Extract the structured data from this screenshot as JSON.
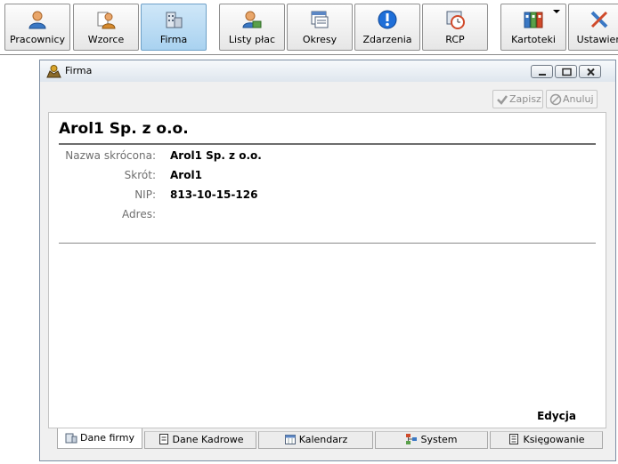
{
  "toolbar": {
    "items": [
      {
        "label": "Pracownicy",
        "icon": "user-icon"
      },
      {
        "label": "Wzorce",
        "icon": "templates-icon"
      },
      {
        "label": "Firma",
        "icon": "building-icon",
        "active": true
      },
      {
        "label": "Listy płac",
        "icon": "payroll-icon"
      },
      {
        "label": "Okresy",
        "icon": "periods-icon"
      },
      {
        "label": "Zdarzenia",
        "icon": "info-icon"
      },
      {
        "label": "RCP",
        "icon": "rcp-clock-icon"
      },
      {
        "label": "Kartoteki",
        "icon": "binders-icon",
        "has_dropdown": true
      },
      {
        "label": "Ustawien",
        "icon": "tools-icon"
      }
    ]
  },
  "window": {
    "title": "Firma",
    "save_label": "Zapisz",
    "cancel_label": "Anuluj",
    "company_name": "Arol1 Sp. z o.o.",
    "fields": [
      {
        "label": "Nazwa skrócona:",
        "value": "Arol1 Sp. z o.o."
      },
      {
        "label": "Skrót:",
        "value": "Arol1"
      },
      {
        "label": "NIP:",
        "value": "813-10-15-126"
      },
      {
        "label": "Adres:",
        "value": ""
      }
    ],
    "edit_label": "Edycja"
  },
  "tabs": [
    {
      "label": "Dane firmy",
      "icon": "building-icon",
      "active": true
    },
    {
      "label": "Dane Kadrowe",
      "icon": "document-icon"
    },
    {
      "label": "Kalendarz",
      "icon": "calendar-icon"
    },
    {
      "label": "System",
      "icon": "system-icon"
    },
    {
      "label": "Księgowanie",
      "icon": "ledger-icon"
    }
  ],
  "colors": {
    "active_toolbar_bg": "#a9d2f0",
    "disabled_text": "#8d8d8d",
    "label_text": "#6e6e6e"
  }
}
